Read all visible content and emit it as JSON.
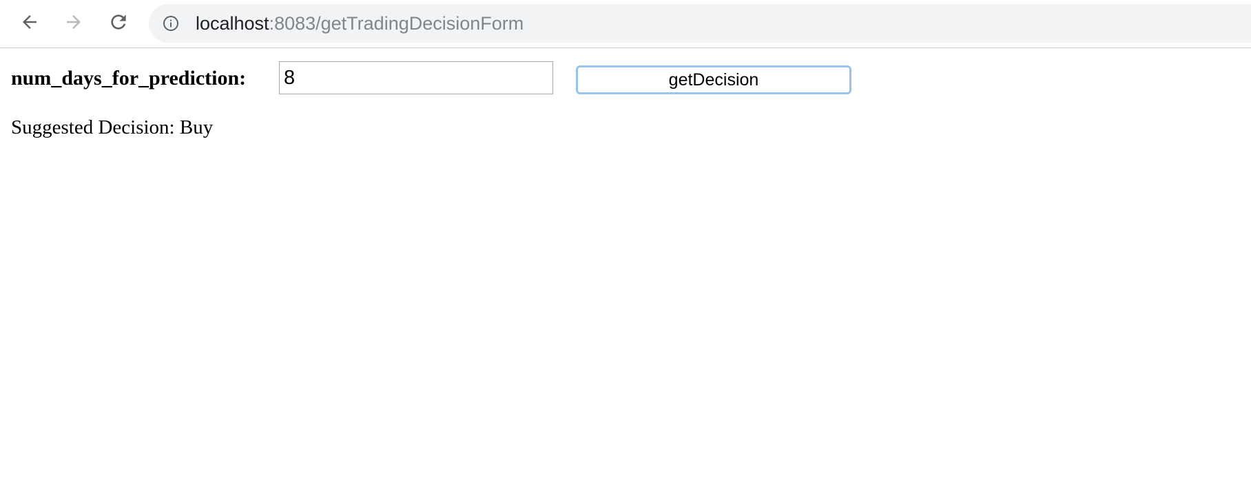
{
  "browser": {
    "back_icon": "arrow-left-icon",
    "forward_icon": "arrow-right-icon",
    "reload_icon": "reload-icon",
    "site_info_icon": "info-icon",
    "address": {
      "host": "localhost",
      "rest": ":8083/getTradingDecisionForm"
    }
  },
  "form": {
    "label": "num_days_for_prediction:",
    "input_value": "8",
    "button_label": "getDecision"
  },
  "result": {
    "text": "Suggested Decision: Buy"
  },
  "colors": {
    "button_focus_border": "#9cc3ef",
    "omnibox_background": "#f1f3f4",
    "url_secondary": "#80868b"
  }
}
